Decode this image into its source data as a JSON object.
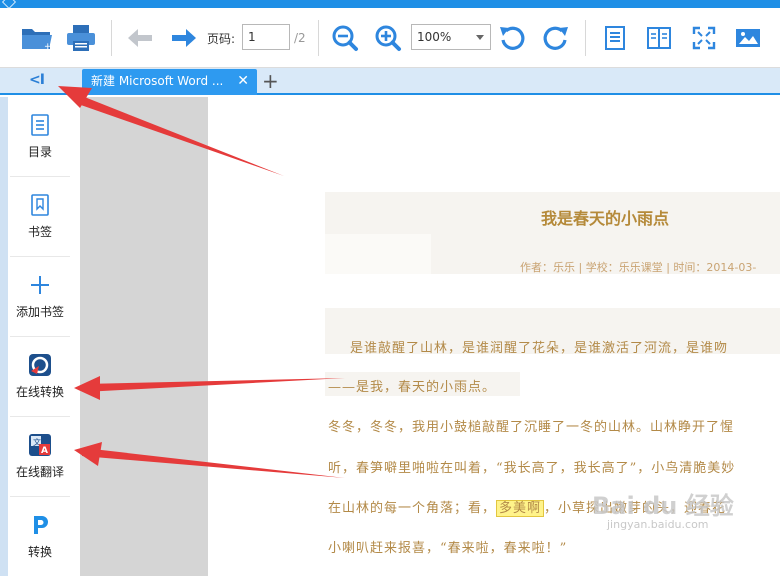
{
  "toolbar": {
    "page_label": "页码:",
    "page_value": "1",
    "page_total": "/2",
    "zoom_value": "100%"
  },
  "tabs": [
    {
      "label": "新建 Microsoft Word ..."
    }
  ],
  "sidebar": {
    "items": [
      {
        "label": "目录"
      },
      {
        "label": "书签"
      },
      {
        "label": "添加书签"
      },
      {
        "label": "在线转换"
      },
      {
        "label": "在线翻译"
      },
      {
        "label": "转换"
      }
    ]
  },
  "document": {
    "title": "我是春天的小雨点",
    "meta": "作者：乐乐 | 学校：乐乐课堂 | 时间：2014-03-",
    "paragraphs": [
      "是谁敲醒了山林，是谁润醒了花朵，是谁激活了河流，是谁吻",
      "——是我，春天的小雨点。",
      "冬冬，冬冬，我用小鼓槌敲醒了沉睡了一冬的山林。山林睁开了惺",
      "听，春笋噼里啪啦在叫着，“我长高了，我长高了”，小鸟清脆美妙",
      "在山林的每一个角落；看，",
      "，小草探出",
      "嫩芽的头，迎春花",
      "小喇叭赶来报喜，“春来啦，春来啦！”"
    ],
    "highlight": "多美啊"
  },
  "watermark": {
    "text": "Bai du 经验",
    "sub": "jingyan.baidu.com"
  },
  "colors": {
    "accent": "#1f8fe6",
    "tab_active": "#2e9af0",
    "annotation_arrow": "#e53b3b",
    "doc_text": "#b38a48"
  }
}
